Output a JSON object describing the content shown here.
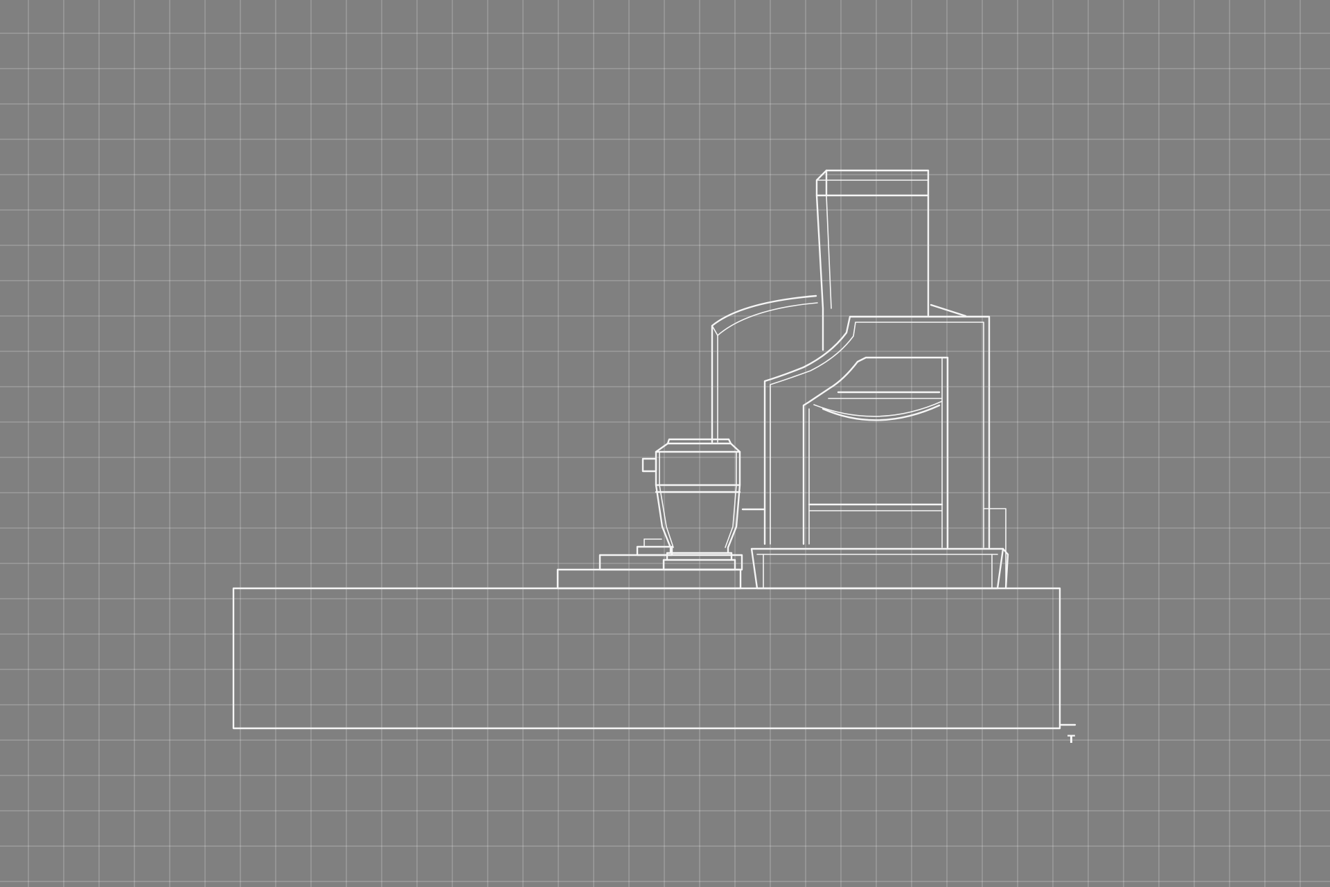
{
  "drawing": {
    "corner_mark": "T",
    "colors": {
      "background": "#808080",
      "grid": "#9a9a9a",
      "line": "#f6f6f6"
    }
  }
}
